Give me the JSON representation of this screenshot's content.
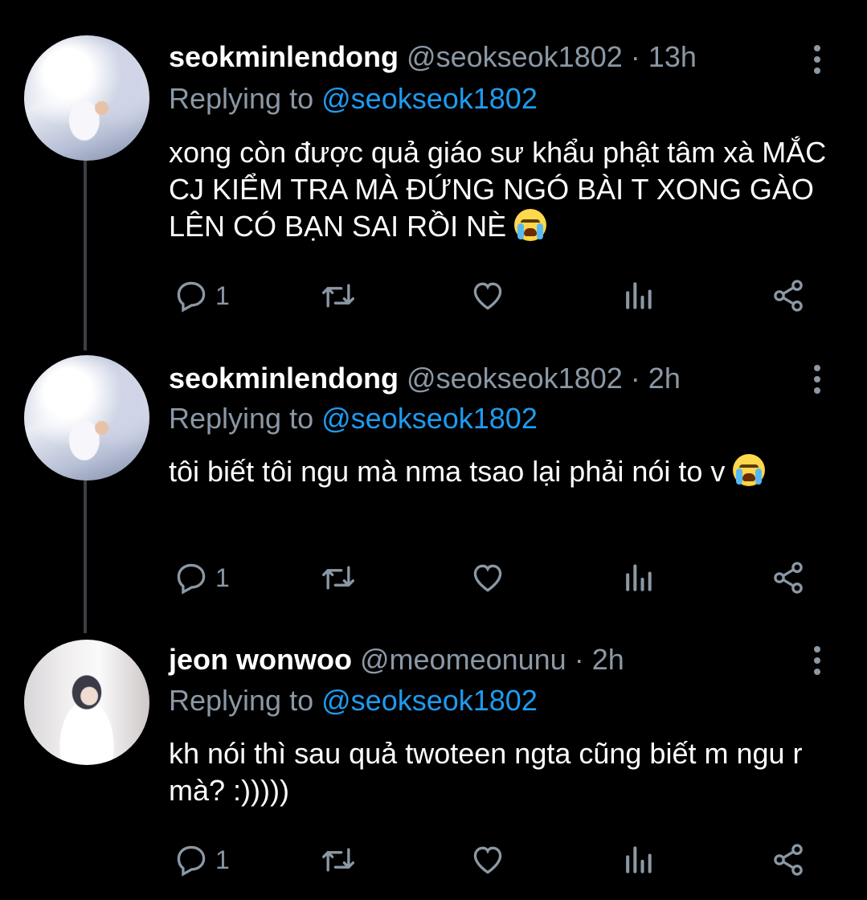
{
  "colors": {
    "background": "#000000",
    "text": "#ffffff",
    "muted": "#8b98a5",
    "mention": "#1d9bf0",
    "thread_line": "#3a3f45"
  },
  "tweets": [
    {
      "name": "seokminlendong",
      "handle": "@seokseok1802",
      "separator": "·",
      "time": "13h",
      "replying_label": "Replying to",
      "replying_to": "@seokseok1802",
      "text": "xong còn được quả giáo sư khẩu phật tâm xà MẮC CJ KIỂM TRA MÀ ĐỨNG NGÓ BÀI T XONG GÀO LÊN CÓ BẠN SAI RỒI NÈ",
      "emoji": "loudly-crying-face",
      "reply_count": "1",
      "icons": [
        "reply-icon",
        "retweet-icon",
        "like-icon",
        "analytics-icon",
        "share-icon"
      ]
    },
    {
      "name": "seokminlendong",
      "handle": "@seokseok1802",
      "separator": "·",
      "time": "2h",
      "replying_label": "Replying to",
      "replying_to": "@seokseok1802",
      "text": "tôi biết tôi ngu mà nma tsao lại phải nói to v",
      "emoji": "loudly-crying-face",
      "reply_count": "1",
      "icons": [
        "reply-icon",
        "retweet-icon",
        "like-icon",
        "analytics-icon",
        "share-icon"
      ]
    },
    {
      "name": "jeon wonwoo",
      "handle": "@meomeonunu",
      "separator": "·",
      "time": "2h",
      "replying_label": "Replying to",
      "replying_to": "@seokseok1802",
      "text": "kh nói thì sau quả twoteen ngta cũng biết m ngu r mà? :)))))",
      "emoji": "",
      "reply_count": "1",
      "icons": [
        "reply-icon",
        "retweet-icon",
        "like-icon",
        "analytics-icon",
        "share-icon"
      ]
    }
  ]
}
